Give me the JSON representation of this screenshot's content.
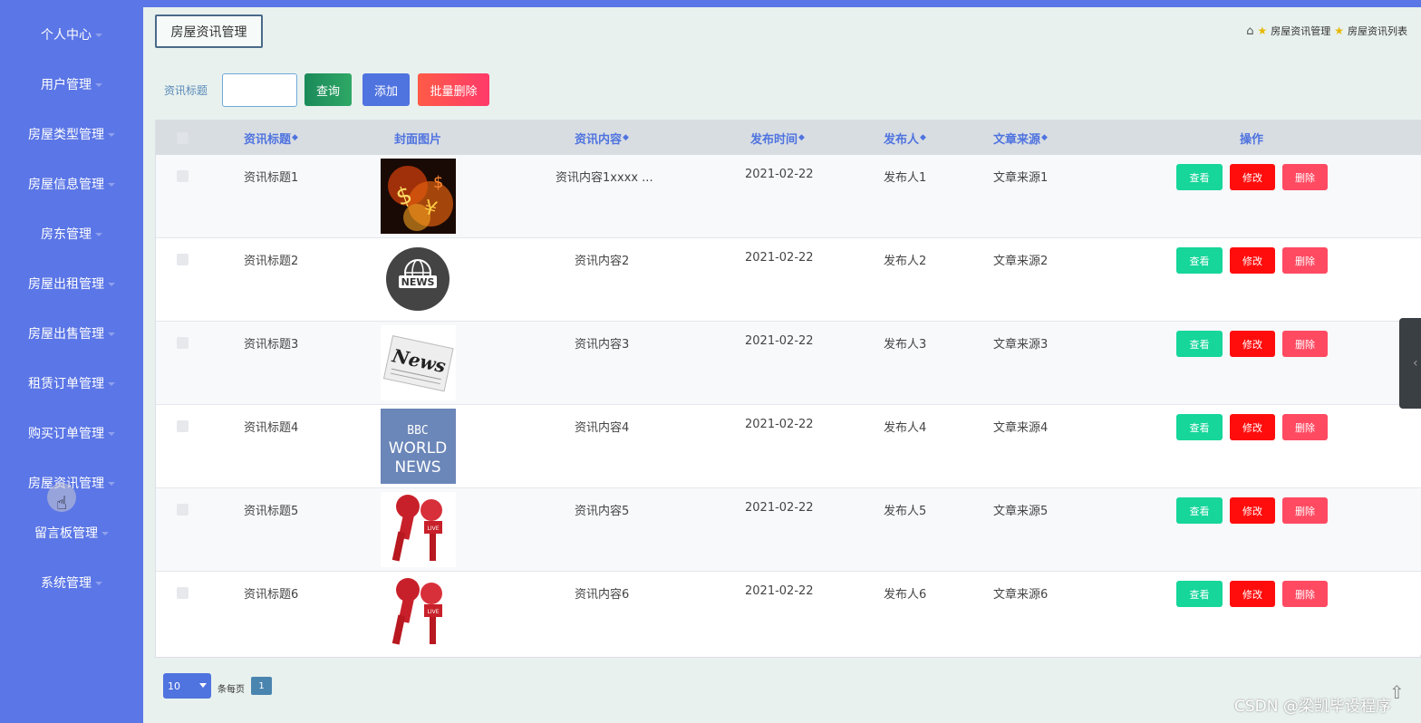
{
  "sidebar": {
    "items": [
      {
        "label": "个人中心"
      },
      {
        "label": "用户管理"
      },
      {
        "label": "房屋类型管理"
      },
      {
        "label": "房屋信息管理"
      },
      {
        "label": "房东管理"
      },
      {
        "label": "房屋出租管理"
      },
      {
        "label": "房屋出售管理"
      },
      {
        "label": "租赁订单管理"
      },
      {
        "label": "购买订单管理"
      },
      {
        "label": "房屋资讯管理"
      },
      {
        "label": "留言板管理"
      },
      {
        "label": "系统管理"
      }
    ]
  },
  "header": {
    "page_tab": "房屋资讯管理",
    "breadcrumb": [
      "房屋资讯管理",
      "房屋资讯列表"
    ]
  },
  "search": {
    "label": "资讯标题",
    "value": "",
    "query_label": "查询",
    "add_label": "添加",
    "batch_delete_label": "批量删除"
  },
  "table": {
    "columns": [
      "资讯标题",
      "封面图片",
      "资讯内容",
      "发布时间",
      "发布人",
      "文章来源",
      "操作"
    ],
    "rows": [
      {
        "title": "资讯标题1",
        "content": "资讯内容1xxxx ...",
        "date": "2021-02-22",
        "author": "发布人1",
        "source": "文章来源1",
        "image": "dollar-fire-image"
      },
      {
        "title": "资讯标题2",
        "content": "资讯内容2",
        "date": "2021-02-22",
        "author": "发布人2",
        "source": "文章来源2",
        "image": "news-globe-image"
      },
      {
        "title": "资讯标题3",
        "content": "资讯内容3",
        "date": "2021-02-22",
        "author": "发布人3",
        "source": "文章来源3",
        "image": "newspaper-image"
      },
      {
        "title": "资讯标题4",
        "content": "资讯内容4",
        "date": "2021-02-22",
        "author": "发布人4",
        "source": "文章来源4",
        "image": "bbc-world-news-image"
      },
      {
        "title": "资讯标题5",
        "content": "资讯内容5",
        "date": "2021-02-22",
        "author": "发布人5",
        "source": "文章来源5",
        "image": "live-microphone-image"
      },
      {
        "title": "资讯标题6",
        "content": "资讯内容6",
        "date": "2021-02-22",
        "author": "发布人6",
        "source": "文章来源6",
        "image": "live-microphone-image"
      }
    ],
    "actions": {
      "view": "查看",
      "edit": "修改",
      "delete": "删除"
    }
  },
  "pagination": {
    "page_size": "10",
    "per_page_label": "条每页",
    "current_page": "1"
  },
  "image_text": {
    "news_badge": "NEWS",
    "newspaper": "News",
    "bbc": "BBC",
    "world": "WORLD",
    "news": "NEWS",
    "live": "LIVE"
  },
  "watermark": "CSDN @梁凯毕设程序",
  "colors": {
    "sidebar": "#5b76e6",
    "primary": "#4f73df",
    "view": "#16d69a",
    "edit": "#ff0d0d",
    "delete": "#ff4a62"
  }
}
